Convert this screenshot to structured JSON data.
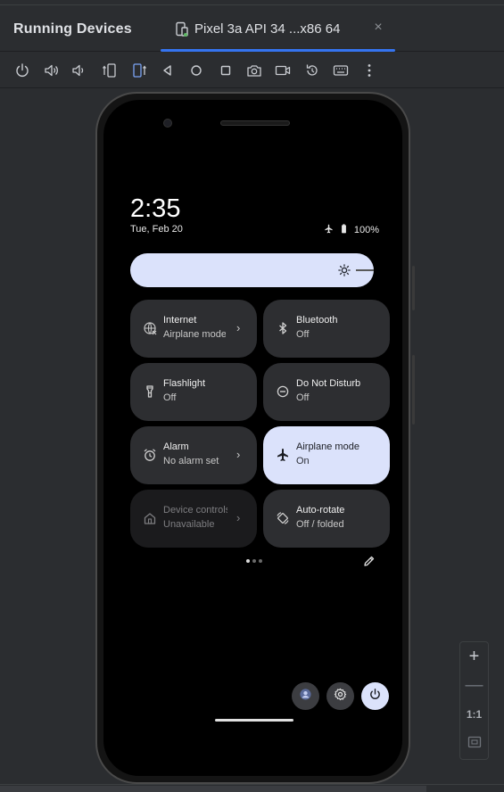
{
  "panel": {
    "title": "Running Devices"
  },
  "tab": {
    "label": "Pixel 3a API 34 ...x86 64",
    "close": "×"
  },
  "toolbar": {
    "buttons": [
      "power-icon",
      "volume-up-icon",
      "volume-down-icon",
      "rotate-left-icon",
      "rotate-right-icon",
      "back-icon",
      "home-icon",
      "overview-icon",
      "screenshot-icon",
      "record-icon",
      "reset-icon",
      "keyboard-icon",
      "more-icon"
    ]
  },
  "phone": {
    "time": "2:35",
    "date": "Tue, Feb 20",
    "battery": "100%",
    "brightness_level": 0.88,
    "tiles": [
      {
        "title": "Internet",
        "subtitle": "Airplane mode",
        "icon": "globe-off-icon",
        "chevron": "›",
        "state": "normal"
      },
      {
        "title": "Bluetooth",
        "subtitle": "Off",
        "icon": "bluetooth-icon",
        "state": "normal"
      },
      {
        "title": "Flashlight",
        "subtitle": "Off",
        "icon": "flashlight-icon",
        "state": "normal"
      },
      {
        "title": "Do Not Disturb",
        "subtitle": "Off",
        "icon": "do-not-disturb-icon",
        "state": "normal"
      },
      {
        "title": "Alarm",
        "subtitle": "No alarm set",
        "icon": "alarm-icon",
        "chevron": "›",
        "state": "normal"
      },
      {
        "title": "Airplane mode",
        "subtitle": "On",
        "icon": "airplane-icon",
        "state": "active"
      },
      {
        "title": "Device controls",
        "subtitle": "Unavailable",
        "icon": "home-controls-icon",
        "chevron": "›",
        "state": "unavailable"
      },
      {
        "title": "Auto-rotate",
        "subtitle": "Off / folded",
        "icon": "rotate-icon",
        "state": "normal"
      }
    ],
    "page_count": 3,
    "current_page": 1
  },
  "zoom": {
    "plus": "+",
    "minus": "—",
    "one_to_one": "1:1"
  },
  "colors": {
    "accent": "#3574f0",
    "tile_active": "#dbe2fb",
    "tile": "#2d2e31",
    "background": "#2b2d30"
  }
}
